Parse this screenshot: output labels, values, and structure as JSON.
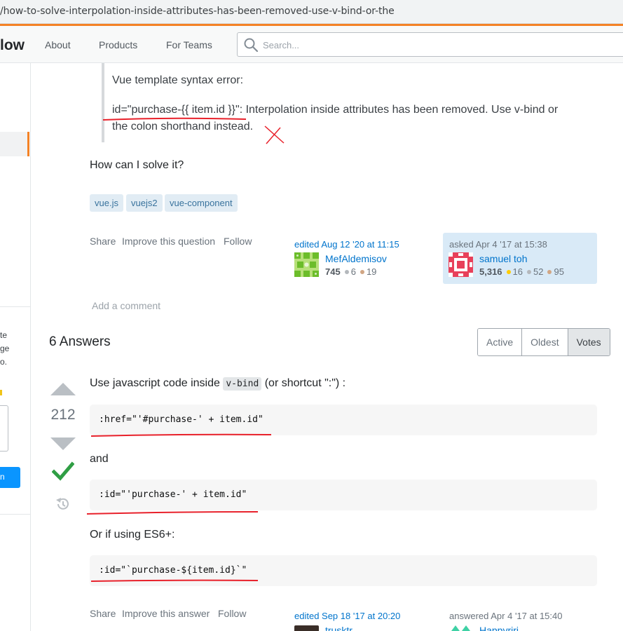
{
  "browser": {
    "url": "/how-to-solve-interpolation-inside-attributes-has-been-removed-use-v-bind-or-the"
  },
  "topbar": {
    "logo_text": "low",
    "nav": [
      "About",
      "Products",
      "For Teams"
    ],
    "search_placeholder": "Search..."
  },
  "sidebar": {
    "snippets": [
      "te",
      "ge",
      "o.",
      "n"
    ]
  },
  "question": {
    "quote_line1": "Vue template syntax error:",
    "quote_line2": "id=\"purchase-{{ item.id }}\": Interpolation inside attributes has been removed. Use v-bind or",
    "quote_line3": "the colon shorthand instead.",
    "ask_text": "How can I solve it?",
    "tags": [
      "vue.js",
      "vuejs2",
      "vue-component"
    ],
    "menu": [
      "Share",
      "Improve this question",
      "Follow"
    ],
    "editor": {
      "action": "edited Aug 12 '20 at 11:15",
      "name": "MefAldemisov",
      "rep": "745",
      "silver": "6",
      "bronze": "19"
    },
    "owner": {
      "action": "asked Apr 4 '17 at 15:38",
      "name": "samuel toh",
      "rep": "5,316",
      "gold": "16",
      "silver": "52",
      "bronze": "95"
    },
    "add_comment": "Add a comment"
  },
  "answers": {
    "heading": "6 Answers",
    "sort_options": [
      "Active",
      "Oldest",
      "Votes"
    ],
    "sort_active": "Votes"
  },
  "answer": {
    "votes": "212",
    "intro_pre": "Use javascript code inside ",
    "intro_code": "v-bind",
    "intro_post": " (or shortcut \":\") :",
    "code1": ":href=\"'#purchase-' + item.id\"",
    "and_text": "and",
    "code2": ":id=\"'purchase-' + item.id\"",
    "es6_text": "Or if using ES6+:",
    "code3": ":id=\"`purchase-${item.id}`\"",
    "menu": [
      "Share",
      "Improve this answer",
      "Follow"
    ],
    "editor": {
      "action": "edited Sep 18 '17 at 20:20",
      "name": "trusktr"
    },
    "owner": {
      "action": "answered Apr 4 '17 at 15:40",
      "name": "Happyriri"
    }
  },
  "colors": {
    "accent": "#f48225",
    "link": "#0074cc",
    "accepted": "#2f9e44",
    "annotation": "#e8212b"
  }
}
